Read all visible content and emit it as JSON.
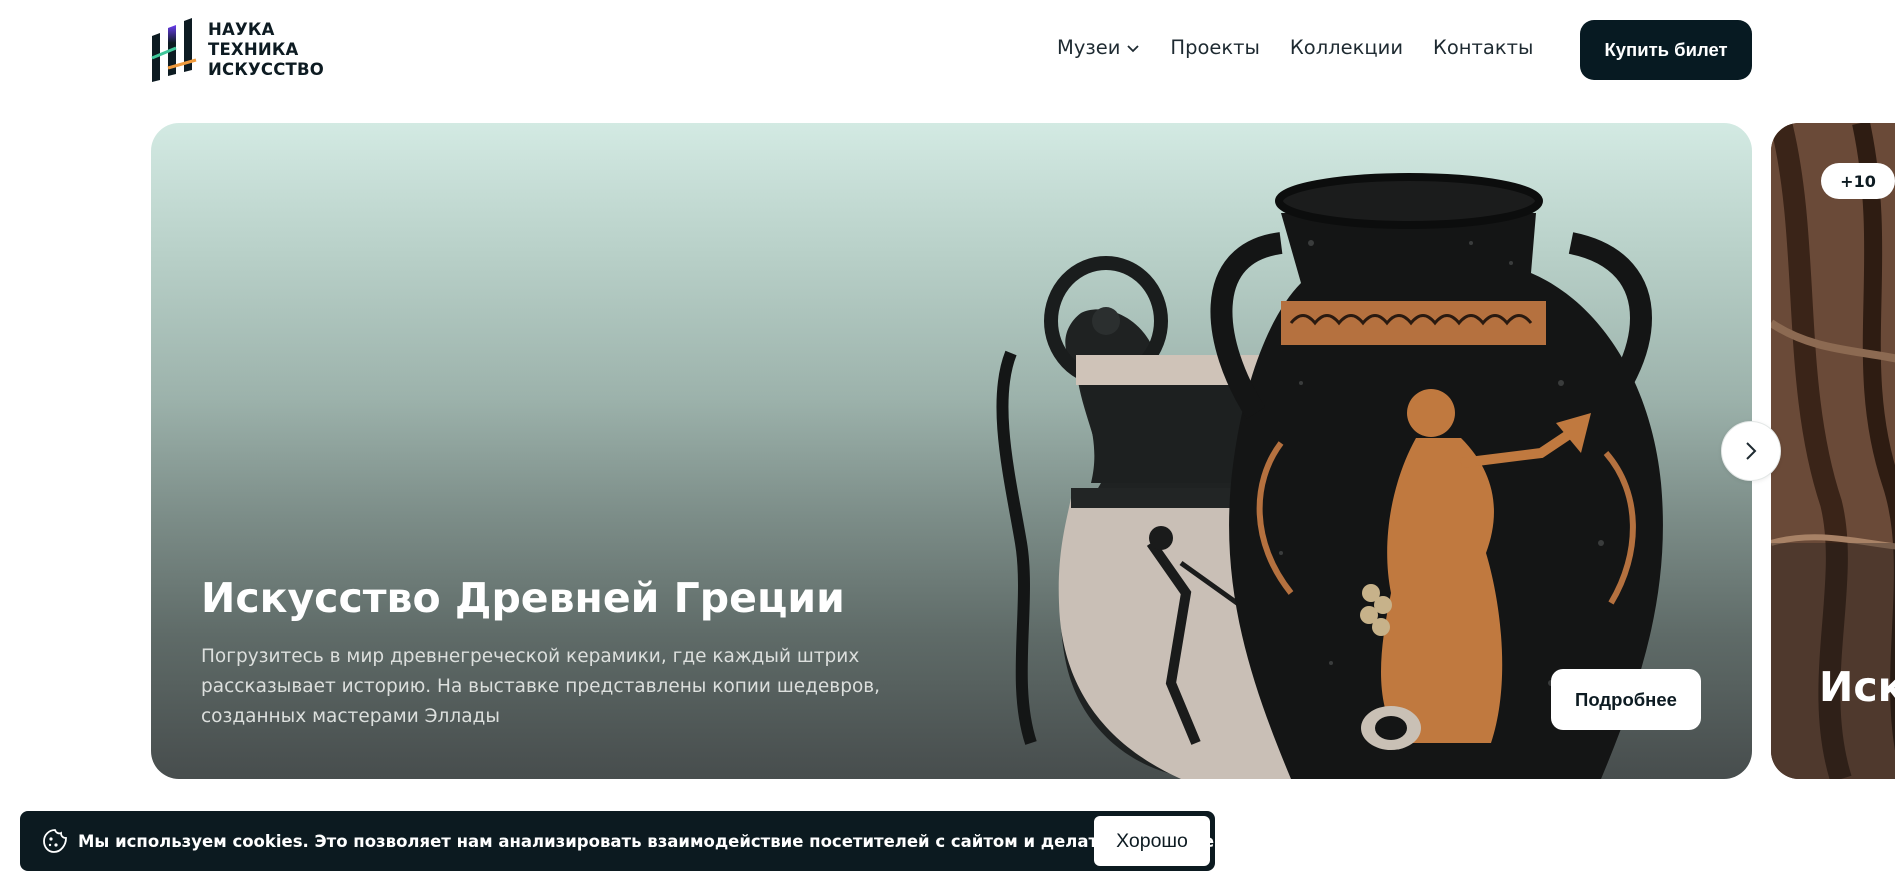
{
  "logo": {
    "lines": [
      "НАУКА",
      "ТЕХНИКА",
      "ИСКУССТВО"
    ],
    "icon": "brand-stripes-logo"
  },
  "nav": {
    "items": [
      {
        "label": "Музеи",
        "has_dropdown": true
      },
      {
        "label": "Проекты"
      },
      {
        "label": "Коллекции"
      },
      {
        "label": "Контакты"
      }
    ],
    "buy_label": "Купить билет"
  },
  "hero": {
    "title": "Искусство Древней Греции",
    "description": "Погрузитесь в мир древнегреческой керамики, где каждый штрих рассказывает историю. На выставке представлены копии шедевров, созданных мастерами Эллады",
    "more_label": "Подробнее",
    "image": "greek-amphora-vases"
  },
  "carousel": {
    "next_icon": "chevron-right-icon"
  },
  "next_card": {
    "badge": "+10",
    "title": "Иск"
  },
  "cookie": {
    "icon": "cookie-icon",
    "text": "Мы используем cookies. Это позволяет нам анализировать взаимодействие посетителей с сайтом и делать его лучше",
    "ok_label": "Хорошо"
  },
  "colors": {
    "primary_dark": "#071a22",
    "hero_top": "#d3eae3",
    "hero_bottom": "#474d4d",
    "logo_purple": "#6a3cf0",
    "logo_green": "#3fc79a",
    "logo_orange": "#f09a3c"
  }
}
